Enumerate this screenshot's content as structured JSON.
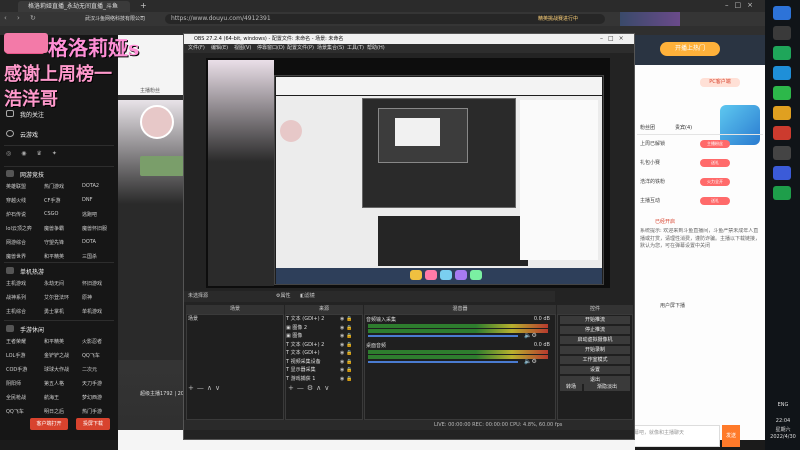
{
  "browser": {
    "tab_title": "格洛莉娅直播_永劫无间直播_斗鱼",
    "url_company": "武汉斗鱼网络科技有限公司",
    "url": "https://www.douyu.com/4912391",
    "promo_text": "精英挑战赛进行中"
  },
  "stream": {
    "streamer_name": "格洛莉娅s",
    "caption_line1": "感谢上周榜一",
    "caption_line2": "浩洋哥",
    "follow_label": "主播粉丝",
    "bottom_hint": "超级主播1792 | 2022.04.06"
  },
  "site_left": {
    "sections": [
      {
        "title": "我的关注",
        "y": 72
      },
      {
        "title": "云游戏",
        "y": 96
      }
    ],
    "categories_title": "网游竞技",
    "items": [
      "英雄联盟",
      "热门游戏",
      "DOTA2",
      "穿越火线",
      "CF手游",
      "DNF",
      "炉石传说",
      "CSGO",
      "逃跑吧",
      "lol云顶之弈",
      "魔兽争霸",
      "魔兽怀旧服",
      "网游综合",
      "守望先锋",
      "DOTA",
      "魔兽世界",
      "和平精英",
      "三国杀"
    ],
    "mobile_title": "单机热游",
    "mobile_items": [
      "主机游戏",
      "永劫无间",
      "怀旧游戏",
      "战神系列",
      "艾尔登法环",
      "原神",
      "主机综合",
      "勇士掌机",
      "单机游戏"
    ],
    "hand_title": "手游休闲",
    "hand_items": [
      "王者荣耀",
      "和平精英",
      "火影忍者",
      "LOL手游",
      "金铲铲之战",
      "QQ飞车",
      "COD手游",
      "球球大作战",
      "二次元",
      "阴阳师",
      "第五人格",
      "天刀手游",
      "全民枪战",
      "航海王",
      "梦幻西游",
      "QQ飞车",
      "明日之后",
      "热门手游"
    ],
    "btn_client": "客户端打开",
    "btn_download": "投屏下载"
  },
  "site_right": {
    "header": "开播上热门",
    "tabs": [
      "粉丝团",
      "贵宾(4)",
      "PC客户端"
    ],
    "rank_rows": [
      {
        "name": "上周已解锁",
        "pill": "主播粉丝"
      },
      {
        "name": "礼包小赛",
        "pill": "送礼"
      },
      {
        "name": "浩洋的铁粉",
        "pill": "火力全开"
      },
      {
        "name": "主播互动",
        "pill": "送礼"
      }
    ],
    "announcement_title": "已经开启",
    "announcement": "系统提示: 欢迎来到斗鱼直播间，斗鱼严禁未成年人直播或打赏，请理性消费，谨防诈骗。主播以下载链接，默认为您，可在弹幕设置中关闭",
    "user_label": "用户屏下播",
    "chat_placeholder": "试着输入弹幕吧，就像和主播聊天",
    "send": "发送"
  },
  "obs": {
    "title": "OBS 27.2.4 (64-bit, windows) - 配置文件: 未命名 - 场景: 未命名",
    "menu": [
      "文件(F)",
      "编辑(E)",
      "视图(V)",
      "停靠窗口(D)",
      "配置文件(P)",
      "场景集合(S)",
      "工具(T)",
      "帮助(H)"
    ],
    "scene_label": "未选择源",
    "props_label": "属性",
    "filters_label": "滤镜",
    "dock_scenes": "场景",
    "dock_sources": "来源",
    "dock_mixer": "混音器",
    "dock_transitions": "转场",
    "dock_controls": "控件",
    "scene_items": [
      "场景"
    ],
    "source_items": [
      "文本 (GDI+) 2",
      "图像 2",
      "图像",
      "文本 (GDI+) 2",
      "文本 (GDI+)",
      "视频采集设备",
      "显示器采集",
      "游戏捕获 1"
    ],
    "mixer_channels": [
      {
        "name": "音频输入采集",
        "db": "0.0 dB"
      },
      {
        "name": "桌面音频",
        "db": "0.0 dB"
      }
    ],
    "controls": [
      "开始推流",
      "停止推流",
      "启动虚拟摄像机",
      "开始录制",
      "工作室模式",
      "设置",
      "退出"
    ],
    "transition_label": "转场",
    "transition_value": "渐隐淡出",
    "status": "LIVE: 00:00:00    REC: 00:00:00    CPU: 4.8%, 60.00 fps"
  },
  "taskbar": {
    "lang": "ENG",
    "time": "22:04",
    "weekday": "星期六",
    "date": "2022/4/30"
  },
  "colors": {
    "accent_red": "#d8432e",
    "pink_title": "#ff8fd6",
    "obs_bg": "#232323",
    "douyu_orange": "#ff7a2a"
  }
}
